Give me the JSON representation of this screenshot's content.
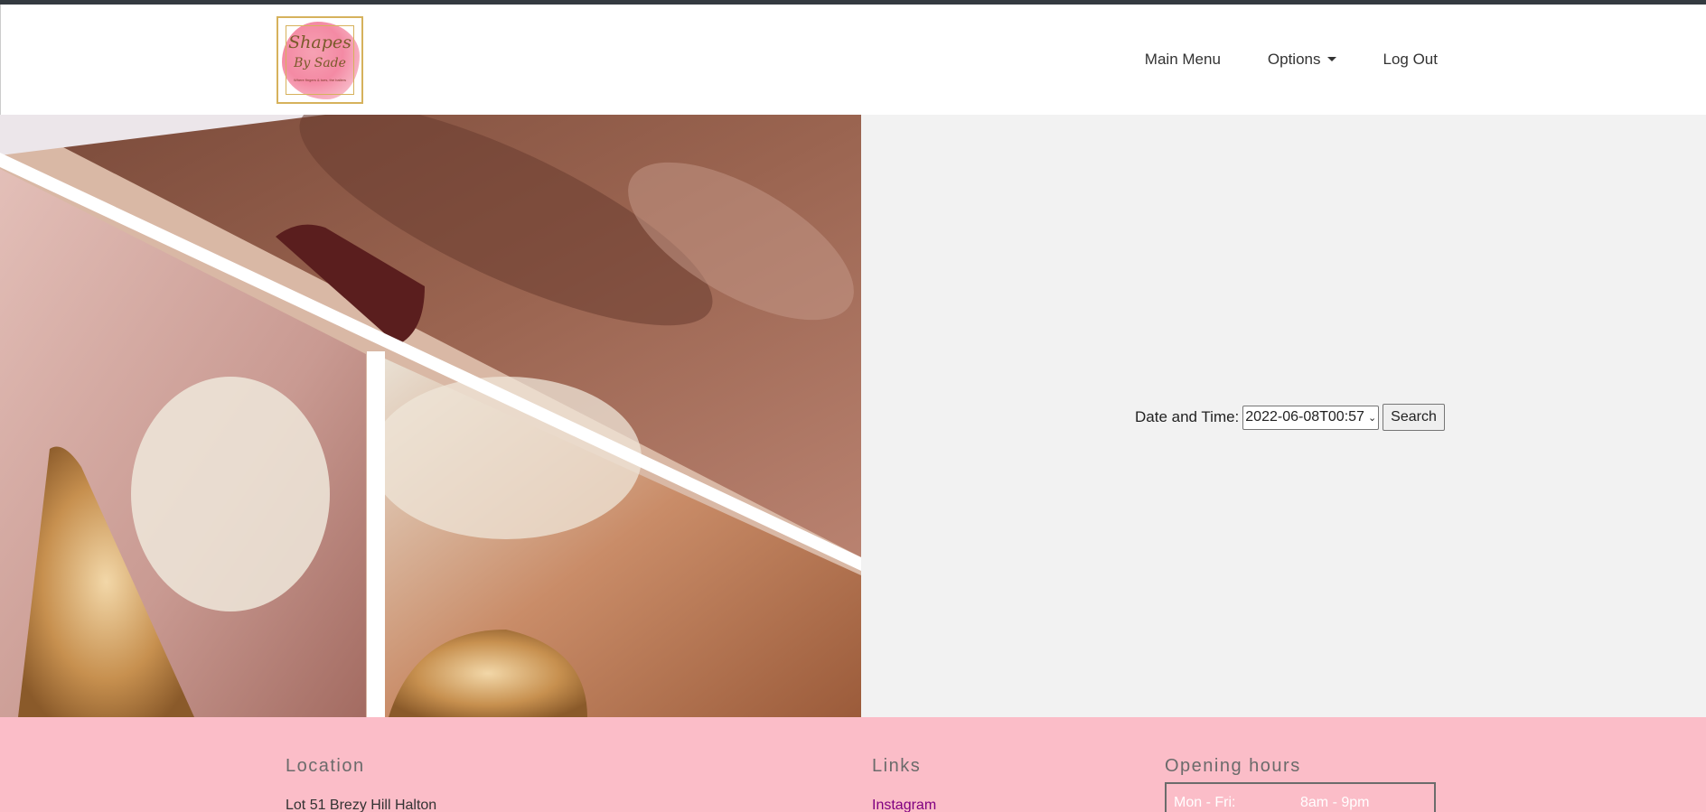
{
  "brand": {
    "logo_line1": "Shapes",
    "logo_line2": "By Sade",
    "logo_tagline": "Where fingers & toes, the ballers",
    "logo_border_color": "#d6b25c"
  },
  "nav": {
    "main_menu": "Main Menu",
    "options": "Options",
    "logout": "Log Out"
  },
  "search": {
    "label": "Date and Time:",
    "selected_value": "2022-06-08T00:57",
    "button_label": "Search"
  },
  "footer": {
    "location_title": "Location",
    "location_line": "Lot 51 Brezy Hill Halton",
    "links_title": "Links",
    "instagram_label": "Instagram",
    "hours_title": "Opening hours",
    "hours": [
      {
        "day": "Mon - Fri:",
        "time": "8am - 9pm"
      }
    ],
    "background_color": "#fbbdc8"
  },
  "colors": {
    "topbar": "#343a40",
    "panel_bg": "#f2f2f2",
    "link_visited": "#800080"
  }
}
